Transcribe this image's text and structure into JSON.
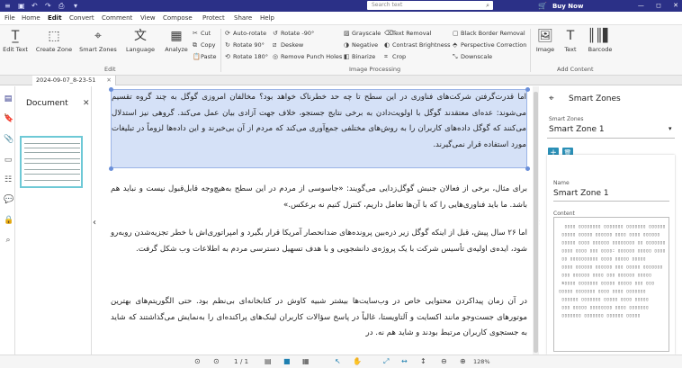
{
  "titlebar": {
    "quick_access": [
      "≡",
      "⬚",
      "↶",
      "↷",
      "⎙",
      "▾"
    ],
    "search_placeholder": "Search text",
    "buy_now": "Buy Now",
    "window_controls": [
      "—",
      "◻",
      "✕"
    ]
  },
  "menu": [
    "File",
    "Home",
    "Edit",
    "Convert",
    "Comment",
    "View",
    "Compose",
    "Protect",
    "Share",
    "Help"
  ],
  "ribbon": {
    "edit_group": {
      "label": "Edit",
      "edit_text": "Edit Text",
      "create_zone": "Create Zone",
      "smart_zones": "Smart Zones",
      "language": "Language",
      "analyze": "Analyze",
      "cut": "Cut",
      "copy": "Copy",
      "paste": "Paste"
    },
    "image_processing": {
      "label": "Image Processing",
      "auto_rotate": "Auto-rotate",
      "rotate_neg90": "Rotate -90°",
      "rotate_90": "Rotate 90°",
      "deskew": "Deskew",
      "rotate_180": "Rotate 180°",
      "remove_punch": "Remove Punch Holes",
      "grayscale": "Grayscale",
      "text_removal": "Text Removal",
      "black_border": "Black Border Removal",
      "negative": "Negative",
      "contrast": "Contrast Brightness",
      "perspective": "Perspective Correction",
      "binarize": "Binarize",
      "crop": "Crop",
      "downscale": "Downscale"
    },
    "add_content": {
      "label": "Add Content",
      "image": "Image",
      "text": "Text",
      "barcode": "Barcode"
    }
  },
  "document_tab": {
    "title": "2024-09-07_8-23-51",
    "close": "✕"
  },
  "document_panel": {
    "title": "Document",
    "close": "✕"
  },
  "document": {
    "paragraphs": [
      "اما قدرت‌گرفتن شرکت‌های فناوری در این سطح تا چه حد خطرناک خواهد بود؟ مخالفان امروزی گوگل به چند گروه تقسیم می‌شوند: عده‌ای معتقدند گوگل با اولویت‌دادن به برخی نتایج جستجو، خلاف جهت آزادی بیان عمل می‌کند. گروهی نیز استدلال می‌کنند که گوگل داده‌های کاربران را به روش‌های مختلفی جمع‌آوری می‌کند که مردم از آن بی‌خبرند و این داده‌ها لزوماً در تبلیغات مورد استفاده قرار نمی‌گیرند.",
      "برای مثال، برخی از فعالان جنبش گوگل‌زدایی می‌گویند: «جاسوسی از مردم در این سطح به‌هیچ‌وجه قابل‌قبول نیست و نباید هم باشد. ما باید فناوری‌هایی را که با آن‌ها تعامل داریم، کنترل کنیم نه برعکس.»",
      "اما ۲۶ سال پیش، قبل از اینکه گوگل زیر ذره‌بین پرونده‌های ضدانحصار آمریکا قرار بگیرد و امپراتوری‌اش با خطر تجزیه‌شدن روبه‌رو شود، ایده‌ی اولیه‌ی تأسیس شرکت با یک پروژه‌ی دانشجویی و با هدف تسهیل دسترسی مردم به اطلاعات وب شکل گرفت.",
      "در آن زمان پیداکردن محتوایی خاص در وب‌سایت‌ها بیشتر شبیه کاوش در کتابخانه‌ای بی‌نظم بود. حتی الگوریتم‌های بهترین موتورهای جست‌وجو مانند اکسایت و آلتاویستا، غالباً در پاسخ سؤالات کاربران لینک‌های پراکنده‌ای را به‌نمایش می‌گذاشتند که شاید به جستجوی کاربران مرتبط بودند و شاید هم نه. در"
    ]
  },
  "smart_zones_panel": {
    "title": "Smart Zones",
    "zone_select_label": "Smart Zones",
    "zone_select_value": "Smart Zone 1",
    "add_button": "+",
    "delete_button": "🗑",
    "name_label": "Name",
    "name_value": "Smart Zone 1",
    "content_label": "Content",
    "content_text": "  ▯▯▯▯ ▯▯▯▯▯▯▯▯ ▯▯▯▯▯▯▯ ▯▯▯▯▯▯▯ ▯▯▯▯▯▯ ▯▯▯▯\n ▯▯▯▯▯ ▯▯▯▯▯ ▯▯▯▯▯▯ ▯▯▯▯ ▯▯▯▯ ▯▯▯▯▯▯\n ▯▯▯▯▯ ▯▯▯▯ ▯▯▯▯▯▯ ▯▯▯▯▯▯▯▯ ▯▯ ▯▯▯▯▯▯▯\n ▯▯▯▯ ▯▯▯▯ ▯▯▯ ▯▯▯▯: ▯▯▯▯▯▯ ▯▯▯▯▯ ▯▯▯▯\n ▯▯ ▯▯▯▯▯▯▯▯▯▯ ▯▯▯▯ ▯▯▯▯▯ ▯▯▯▯▯\n ▯▯▯▯ ▯▯▯▯▯▯ ▯▯▯▯▯▯ ▯▯▯ ▯▯▯▯▯ ▯▯▯▯▯▯▯\n ▯▯▯ ▯▯▯▯▯▯ ▯▯▯▯ ▯▯▯ ▯▯▯▯▯▯ ▯▯▯▯▯\n s▯▯▯▯ ▯▯▯▯▯▯▯ ▯▯▯▯▯ ▯▯▯▯▯ ▯▯▯ ▯▯▯\n▯▯▯▯▯ ▯▯▯▯▯▯▯ ▯▯▯▯ ▯▯▯▯ ▯▯▯▯▯▯▯\n ▯▯▯▯▯▯ ▯▯▯▯▯▯▯ ▯▯▯▯▯ ▯▯▯▯ ▯▯▯▯▯\n ▯▯▯ ▯▯▯▯▯ ▯▯▯▯▯▯▯▯ ▯▯▯▯ ▯▯▯▯▯▯▯\n ▯▯▯▯▯▯▯ ▯▯▯▯▯▯▯ ▯▯▯▯▯▯ ▯▯▯▯▯"
  },
  "statusbar": {
    "page_current": "1",
    "page_total": "/ 1",
    "zoom": "128%"
  }
}
